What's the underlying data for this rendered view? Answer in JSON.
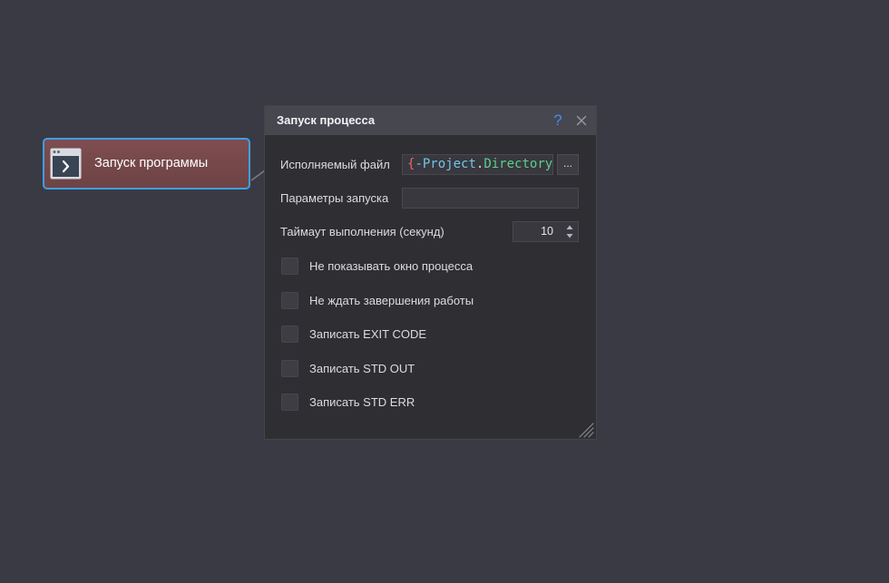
{
  "canvas": {
    "background": "#3a3a44"
  },
  "node": {
    "label": "Запуск программы",
    "icon": "terminal-window-icon",
    "border_color": "#3e9fe8"
  },
  "connector": {
    "icon": "connector-line"
  },
  "dialog": {
    "title": "Запуск процесса",
    "help": {
      "icon": "help-icon",
      "glyph": "?",
      "color": "#3f8ff0"
    },
    "close": {
      "icon": "close-icon"
    },
    "executable": {
      "label": "Исполняемый файл",
      "value_parts": [
        {
          "text": "{",
          "color": "#e86868"
        },
        {
          "text": "-Project",
          "color": "#74c6e8"
        },
        {
          "text": ".",
          "color": "#d8d8dc"
        },
        {
          "text": "Directory",
          "color": "#5ccf8e"
        }
      ],
      "browse_label": "..."
    },
    "parameters": {
      "label": "Параметры запуска",
      "value": ""
    },
    "timeout": {
      "label": "Таймаут выполнения (секунд)",
      "value": "10",
      "up_icon": "spin-up-icon",
      "down_icon": "spin-down-icon"
    },
    "options": [
      {
        "label": "Не показывать окно процесса",
        "checked": false
      },
      {
        "label": "Не ждать завершения работы",
        "checked": false
      },
      {
        "label": "Записать EXIT CODE",
        "checked": false
      },
      {
        "label": "Записать STD OUT",
        "checked": false
      },
      {
        "label": "Записать STD ERR",
        "checked": false
      }
    ],
    "resize_grip": {
      "icon": "resize-grip-icon"
    }
  }
}
